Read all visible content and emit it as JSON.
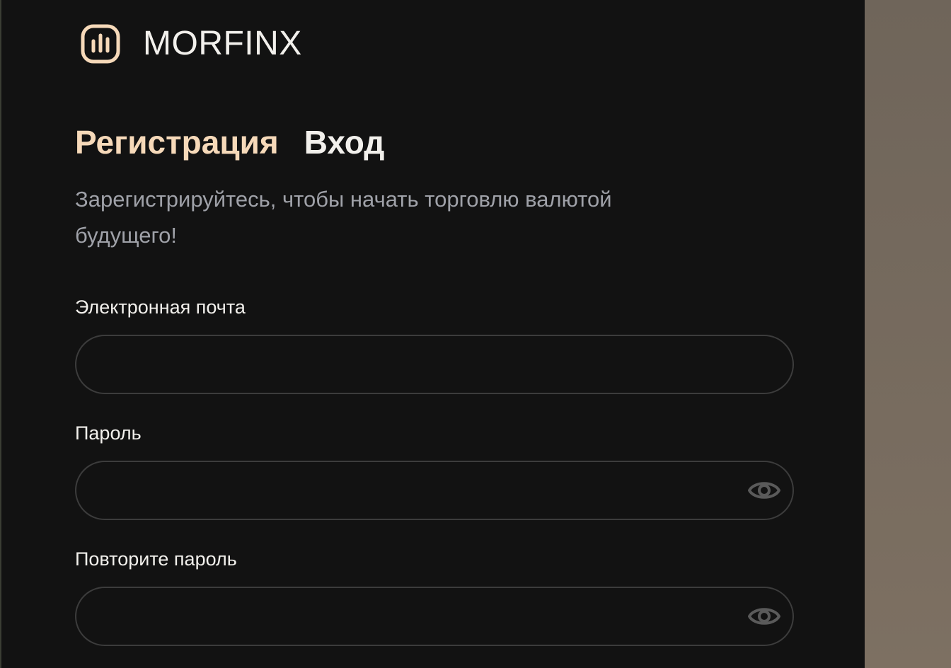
{
  "brand": {
    "name": "MORFINX",
    "accent_color": "#f6d9b9"
  },
  "tabs": [
    {
      "label": "Регистрация",
      "active": true
    },
    {
      "label": "Вход",
      "active": false
    }
  ],
  "subtitle": "Зарегистрируйтесь, чтобы начать торговлю валютой будущего!",
  "form": {
    "email": {
      "label": "Электронная почта",
      "value": "",
      "placeholder": ""
    },
    "password": {
      "label": "Пароль",
      "value": "",
      "placeholder": "",
      "icon": "eye-icon"
    },
    "repeat_password": {
      "label": "Повторите пароль",
      "value": "",
      "placeholder": "",
      "icon": "eye-icon"
    }
  }
}
